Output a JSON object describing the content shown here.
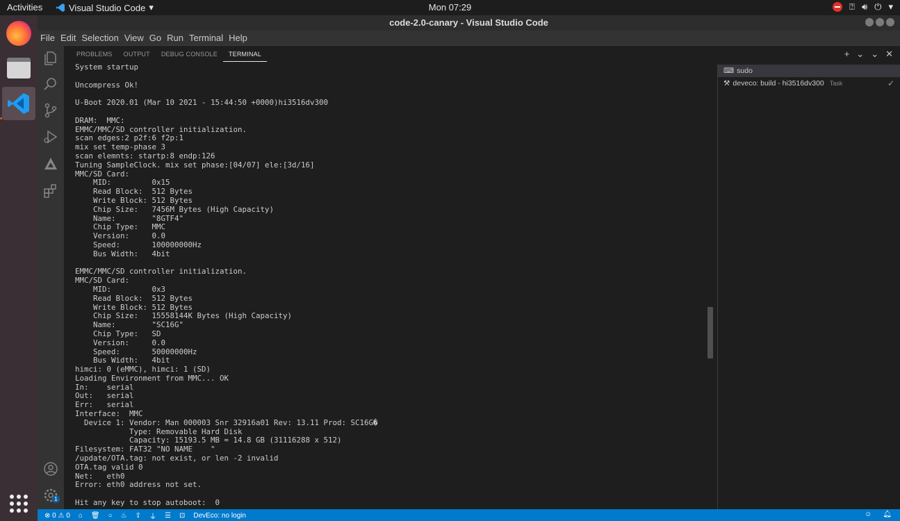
{
  "topbar": {
    "activities": "Activities",
    "app_name": "Visual Studio Code",
    "clock": "Mon 07:29"
  },
  "window": {
    "title": "code-2.0-canary - Visual Studio Code"
  },
  "menu": [
    "File",
    "Edit",
    "Selection",
    "View",
    "Go",
    "Run",
    "Terminal",
    "Help"
  ],
  "panel": {
    "tabs": [
      "PROBLEMS",
      "OUTPUT",
      "DEBUG CONSOLE",
      "TERMINAL"
    ],
    "active_tab": "TERMINAL"
  },
  "terminal_lines": [
    "System startup",
    "",
    "Uncompress Ok!",
    "",
    "U-Boot 2020.01 (Mar 10 2021 - 15:44:50 +0000)hi3516dv300",
    "",
    "DRAM:  MMC:",
    "EMMC/MMC/SD controller initialization.",
    "scan edges:2 p2f:6 f2p:1",
    "mix set temp-phase 3",
    "scan elemnts: startp:8 endp:126",
    "Tuning SampleClock. mix set phase:[04/07] ele:[3d/16]",
    "MMC/SD Card:",
    "    MID:         0x15",
    "    Read Block:  512 Bytes",
    "    Write Block: 512 Bytes",
    "    Chip Size:   7456M Bytes (High Capacity)",
    "    Name:        \"8GTF4\"",
    "    Chip Type:   MMC",
    "    Version:     0.0",
    "    Speed:       100000000Hz",
    "    Bus Width:   4bit",
    "",
    "EMMC/MMC/SD controller initialization.",
    "MMC/SD Card:",
    "    MID:         0x3",
    "    Read Block:  512 Bytes",
    "    Write Block: 512 Bytes",
    "    Chip Size:   15558144K Bytes (High Capacity)",
    "    Name:        \"SC16G\"",
    "    Chip Type:   SD",
    "    Version:     0.0",
    "    Speed:       50000000Hz",
    "    Bus Width:   4bit",
    "himci: 0 (eMMC), himci: 1 (SD)",
    "Loading Environment from MMC... OK",
    "In:    serial",
    "Out:   serial",
    "Err:   serial",
    "Interface:  MMC",
    "  Device 1: Vendor: Man 000003 Snr 32916a01 Rev: 13.11 Prod: SC16G�",
    "            Type: Removable Hard Disk",
    "            Capacity: 15193.5 MB = 14.8 GB (31116288 x 512)",
    "Filesystem: FAT32 \"NO NAME    \"",
    "/update/OTA.tag: not exist, or len -2 invalid",
    "OTA.tag valid 0",
    "Net:   eth0",
    "Error: eth0 address not set.",
    "",
    "Hit any key to stop autoboot:  0"
  ],
  "terminals": [
    {
      "label": "sudo",
      "suffix": ""
    },
    {
      "label": "deveco: build - hi3516dv300",
      "suffix": "Task"
    }
  ],
  "statusbar": {
    "errors": "0",
    "warnings": "0",
    "deveco": "DevEco: no login",
    "accounts_badge": "1"
  },
  "colors": {
    "statusbar": "#007acc",
    "editor_bg": "#1e1e1e",
    "activitybar": "#333333",
    "dock": "#3a2f35"
  }
}
